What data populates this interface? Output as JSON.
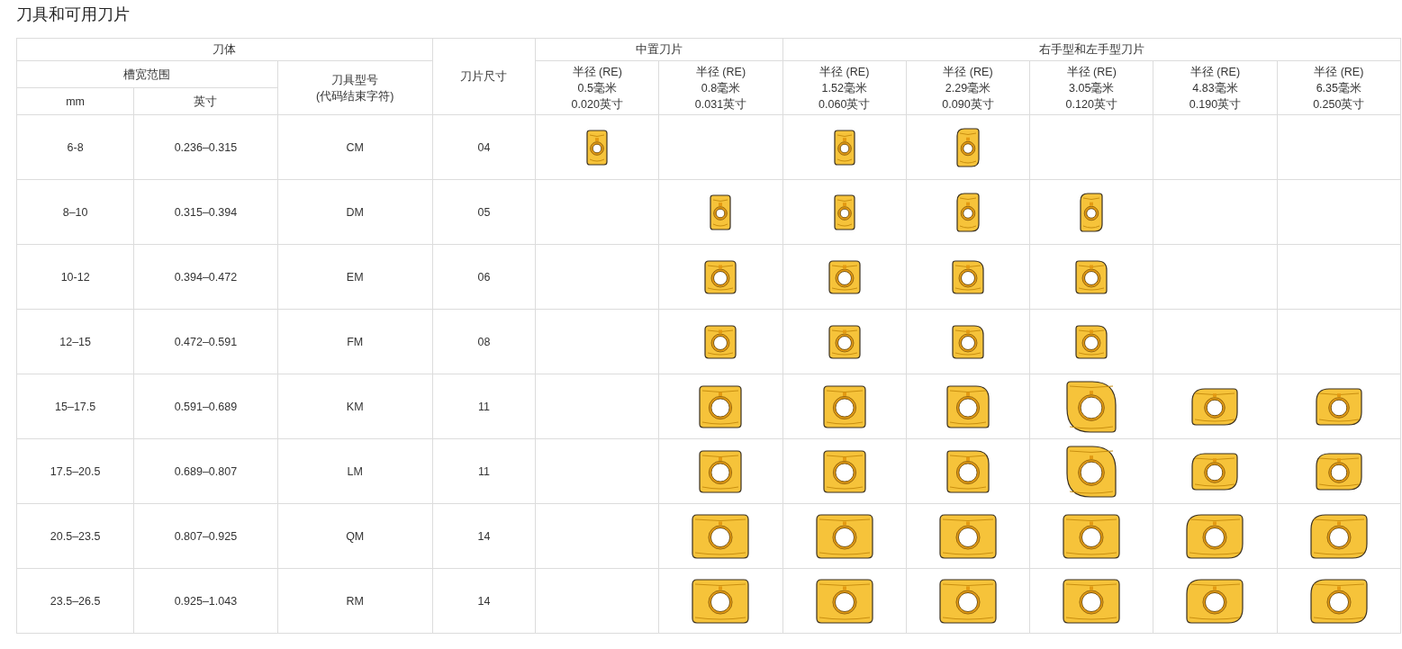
{
  "title": "刀具和可用刀片",
  "table": {
    "header": {
      "body_group": "刀体",
      "slot_range": "槽宽范围",
      "mm": "mm",
      "inch": "英寸",
      "model": [
        "刀具型号",
        "(代码结束字符)"
      ],
      "insert_size": "刀片尺寸",
      "insert_groups": [
        {
          "label": "中置刀片",
          "columns": [
            [
              "半径 (RE)",
              "0.5毫米",
              "0.020英寸"
            ],
            [
              "半径 (RE)",
              "0.8毫米",
              "0.031英寸"
            ]
          ]
        },
        {
          "label": "右手型和左手型刀片",
          "columns": [
            [
              "半径 (RE)",
              "1.52毫米",
              "0.060英寸"
            ],
            [
              "半径 (RE)",
              "2.29毫米",
              "0.090英寸"
            ],
            [
              "半径 (RE)",
              "3.05毫米",
              "0.120英寸"
            ],
            [
              "半径 (RE)",
              "4.83毫米",
              "0.190英寸"
            ],
            [
              "半径 (RE)",
              "6.35毫米",
              "0.250英寸"
            ]
          ]
        }
      ]
    },
    "rows": [
      {
        "mm": "6-8",
        "inch": "0.236–0.315",
        "model": "CM",
        "size": "04",
        "inserts": [
          {
            "kind": "tall"
          },
          {
            "kind": "empty"
          },
          {
            "kind": "tall"
          },
          {
            "kind": "tall-round"
          },
          {
            "kind": "empty"
          },
          {
            "kind": "empty"
          },
          {
            "kind": "empty"
          }
        ]
      },
      {
        "mm": "8–10",
        "inch": "0.315–0.394",
        "model": "DM",
        "size": "05",
        "inserts": [
          {
            "kind": "empty"
          },
          {
            "kind": "tall"
          },
          {
            "kind": "tall"
          },
          {
            "kind": "tall-round"
          },
          {
            "kind": "tall-round"
          },
          {
            "kind": "empty"
          },
          {
            "kind": "empty"
          }
        ]
      },
      {
        "mm": "10-12",
        "inch": "0.394–0.472",
        "model": "EM",
        "size": "06",
        "inserts": [
          {
            "kind": "empty"
          },
          {
            "kind": "chip"
          },
          {
            "kind": "chip"
          },
          {
            "kind": "chip-round"
          },
          {
            "kind": "chip-round"
          },
          {
            "kind": "empty"
          },
          {
            "kind": "empty"
          }
        ]
      },
      {
        "mm": "12–15",
        "inch": "0.472–0.591",
        "model": "FM",
        "size": "08",
        "inserts": [
          {
            "kind": "empty"
          },
          {
            "kind": "chip"
          },
          {
            "kind": "chip"
          },
          {
            "kind": "chip-round"
          },
          {
            "kind": "chip-round"
          },
          {
            "kind": "empty"
          },
          {
            "kind": "empty"
          }
        ]
      },
      {
        "mm": "15–17.5",
        "inch": "0.591–0.689",
        "model": "KM",
        "size": "11",
        "inserts": [
          {
            "kind": "empty"
          },
          {
            "kind": "square"
          },
          {
            "kind": "square"
          },
          {
            "kind": "square-round"
          },
          {
            "kind": "lobed"
          },
          {
            "kind": "corner"
          },
          {
            "kind": "corner"
          }
        ]
      },
      {
        "mm": "17.5–20.5",
        "inch": "0.689–0.807",
        "model": "LM",
        "size": "11",
        "inserts": [
          {
            "kind": "empty"
          },
          {
            "kind": "square"
          },
          {
            "kind": "square"
          },
          {
            "kind": "square-round"
          },
          {
            "kind": "lobed"
          },
          {
            "kind": "corner"
          },
          {
            "kind": "corner"
          }
        ]
      },
      {
        "mm": "20.5–23.5",
        "inch": "0.807–0.925",
        "model": "QM",
        "size": "14",
        "inserts": [
          {
            "kind": "empty"
          },
          {
            "kind": "wide"
          },
          {
            "kind": "wide"
          },
          {
            "kind": "wide"
          },
          {
            "kind": "wide"
          },
          {
            "kind": "wide-round"
          },
          {
            "kind": "wide-round"
          }
        ]
      },
      {
        "mm": "23.5–26.5",
        "inch": "0.925–1.043",
        "model": "RM",
        "size": "14",
        "inserts": [
          {
            "kind": "empty"
          },
          {
            "kind": "wide"
          },
          {
            "kind": "wide"
          },
          {
            "kind": "wide"
          },
          {
            "kind": "wide"
          },
          {
            "kind": "wide-round"
          },
          {
            "kind": "wide-round"
          }
        ]
      }
    ]
  }
}
